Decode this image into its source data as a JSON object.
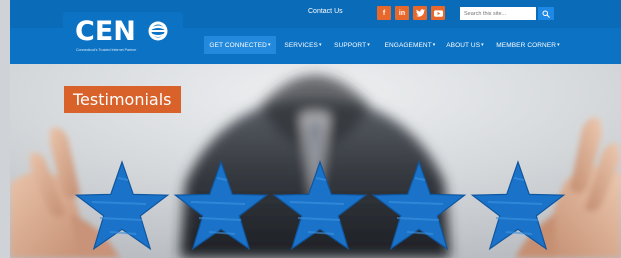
{
  "topbar": {
    "contact_label": "Contact Us",
    "social": [
      {
        "icon": "facebook-icon",
        "glyph": "f"
      },
      {
        "icon": "linkedin-icon",
        "glyph": "in"
      },
      {
        "icon": "twitter-icon",
        "glyph": "✓"
      },
      {
        "icon": "youtube-icon",
        "glyph": "▶"
      }
    ],
    "search_placeholder": "Search this site...",
    "search_icon": "search-icon"
  },
  "logo": {
    "text": "CEN",
    "tagline": "Connecticut's Trusted Internet Partner"
  },
  "nav": {
    "items": [
      {
        "label": "GET CONNECTED",
        "active": true
      },
      {
        "label": "SERVICES",
        "active": false
      },
      {
        "label": "SUPPORT",
        "active": false
      },
      {
        "label": "ENGAGEMENT",
        "active": false
      },
      {
        "label": "ABOUT US",
        "active": false
      },
      {
        "label": "MEMBER CORNER",
        "active": false
      }
    ],
    "caret": "▾"
  },
  "hero": {
    "label": "Testimonials",
    "star_count": 5,
    "colors": {
      "star": "#1a73c9",
      "label_bg": "#d9622a",
      "nav": "#0b72c4",
      "topbar": "#0a6bb8",
      "social": "#e8672a"
    }
  }
}
